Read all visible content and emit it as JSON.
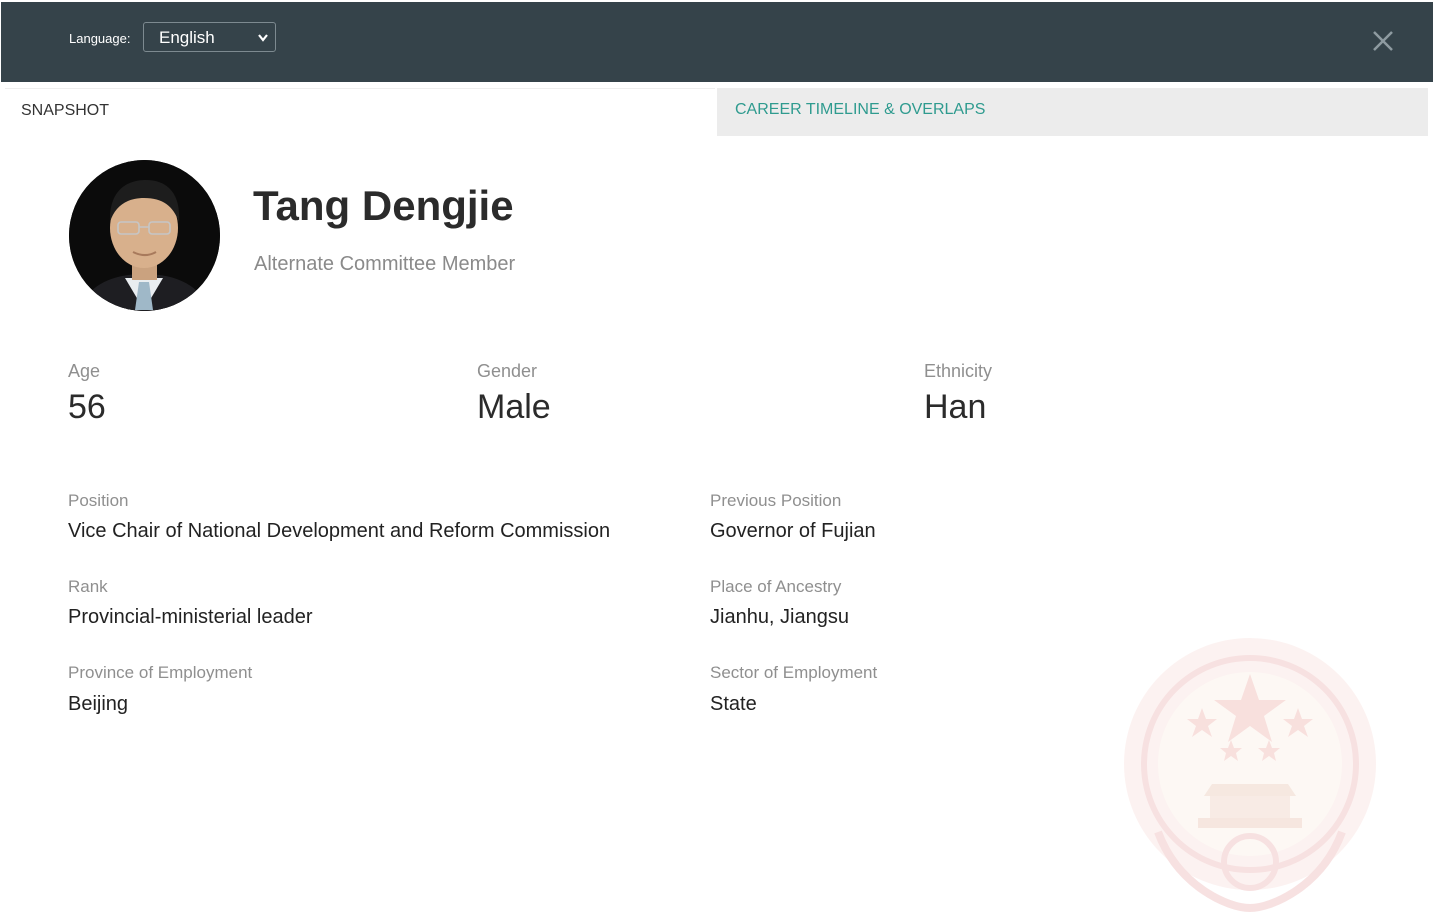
{
  "header": {
    "language_label": "Language:",
    "language_value": "English"
  },
  "tabs": [
    {
      "label": "SNAPSHOT",
      "active": true
    },
    {
      "label": "CAREER TIMELINE & OVERLAPS",
      "active": false
    }
  ],
  "profile": {
    "name": "Tang Dengjie",
    "title": "Alternate Committee Member"
  },
  "stats": [
    {
      "label": "Age",
      "value": "56"
    },
    {
      "label": "Gender",
      "value": "Male"
    },
    {
      "label": "Ethnicity",
      "value": "Han"
    }
  ],
  "details": [
    {
      "label": "Position",
      "value": "Vice Chair of National Development and Reform Commission"
    },
    {
      "label": "Previous Position",
      "value": "Governor of Fujian"
    },
    {
      "label": "Rank",
      "value": "Provincial-ministerial leader"
    },
    {
      "label": "Place of Ancestry",
      "value": "Jianhu, Jiangsu"
    },
    {
      "label": "Province of Employment",
      "value": "Beijing"
    },
    {
      "label": "Sector of Employment",
      "value": "State"
    }
  ],
  "colors": {
    "header_bg": "#35434a",
    "accent_teal": "#2f9b8f",
    "inactive_tab_bg": "#ececec",
    "emblem_tint": "#f3cccc"
  },
  "icons": {
    "close": "close-icon",
    "dropdown": "chevron-down-icon",
    "watermark": "national-emblem-watermark"
  }
}
